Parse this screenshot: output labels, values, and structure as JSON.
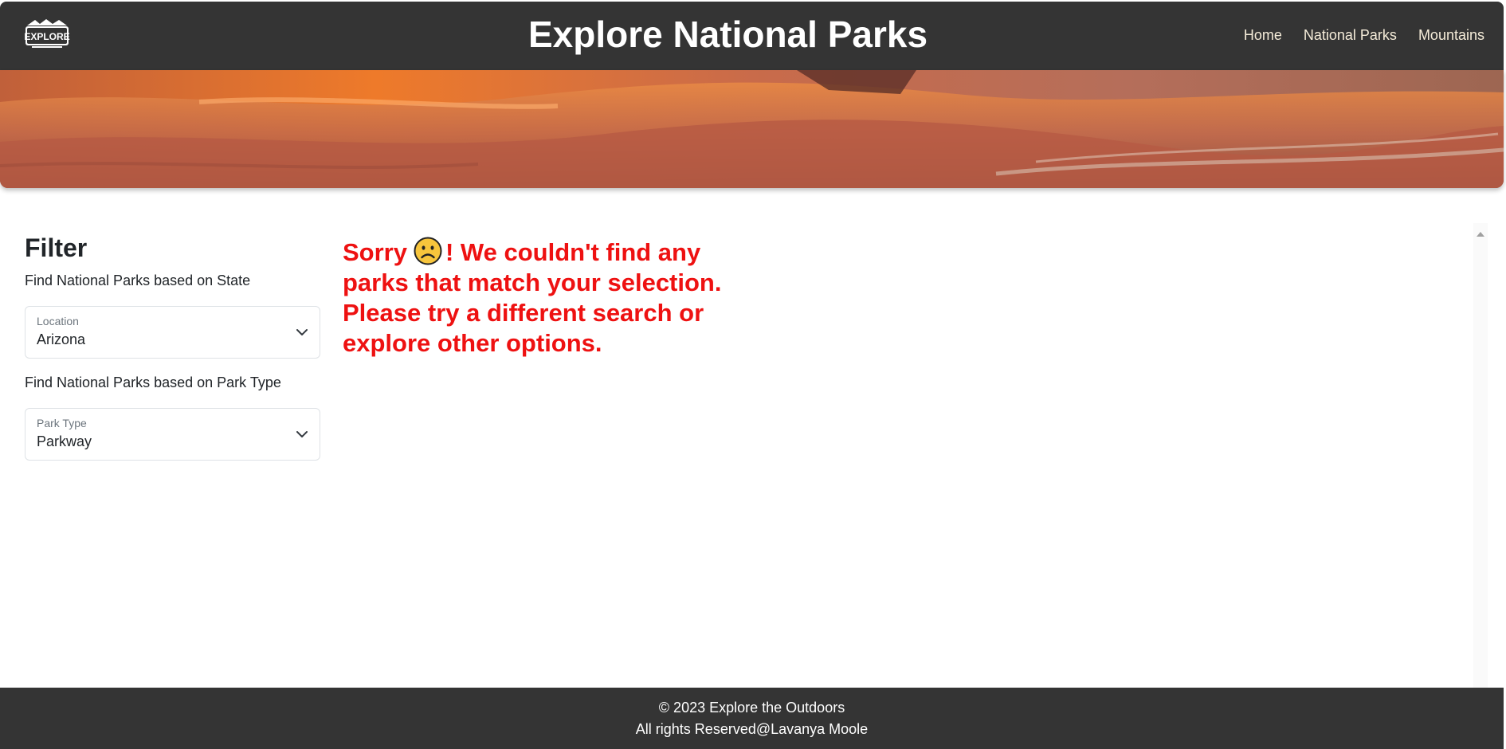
{
  "header": {
    "logo_text": "EXPLORE",
    "title": "Explore National Parks",
    "nav": [
      {
        "label": "Home"
      },
      {
        "label": "National Parks"
      },
      {
        "label": "Mountains"
      }
    ]
  },
  "hero": {
    "image": "red-rock-canyon-banner"
  },
  "filter": {
    "heading": "Filter",
    "state_caption": "Find National Parks based on State",
    "location": {
      "label": "Location",
      "value": "Arizona"
    },
    "type_caption": "Find National Parks based on Park Type",
    "park_type": {
      "label": "Park Type",
      "value": "Parkway"
    }
  },
  "message": {
    "prefix": "Sorry",
    "emoji": "frowning-face",
    "suffix": "! We couldn't find any parks that match your selection. Please try a different search or explore other options."
  },
  "footer": {
    "copyright": "© 2023 Explore the Outdoors",
    "rights": "All rights Reserved@Lavanya Moole"
  },
  "colors": {
    "header_bg": "#343434",
    "nav_link": "#f5ecd9",
    "message": "#ee1111",
    "footer_bg": "#343434"
  }
}
